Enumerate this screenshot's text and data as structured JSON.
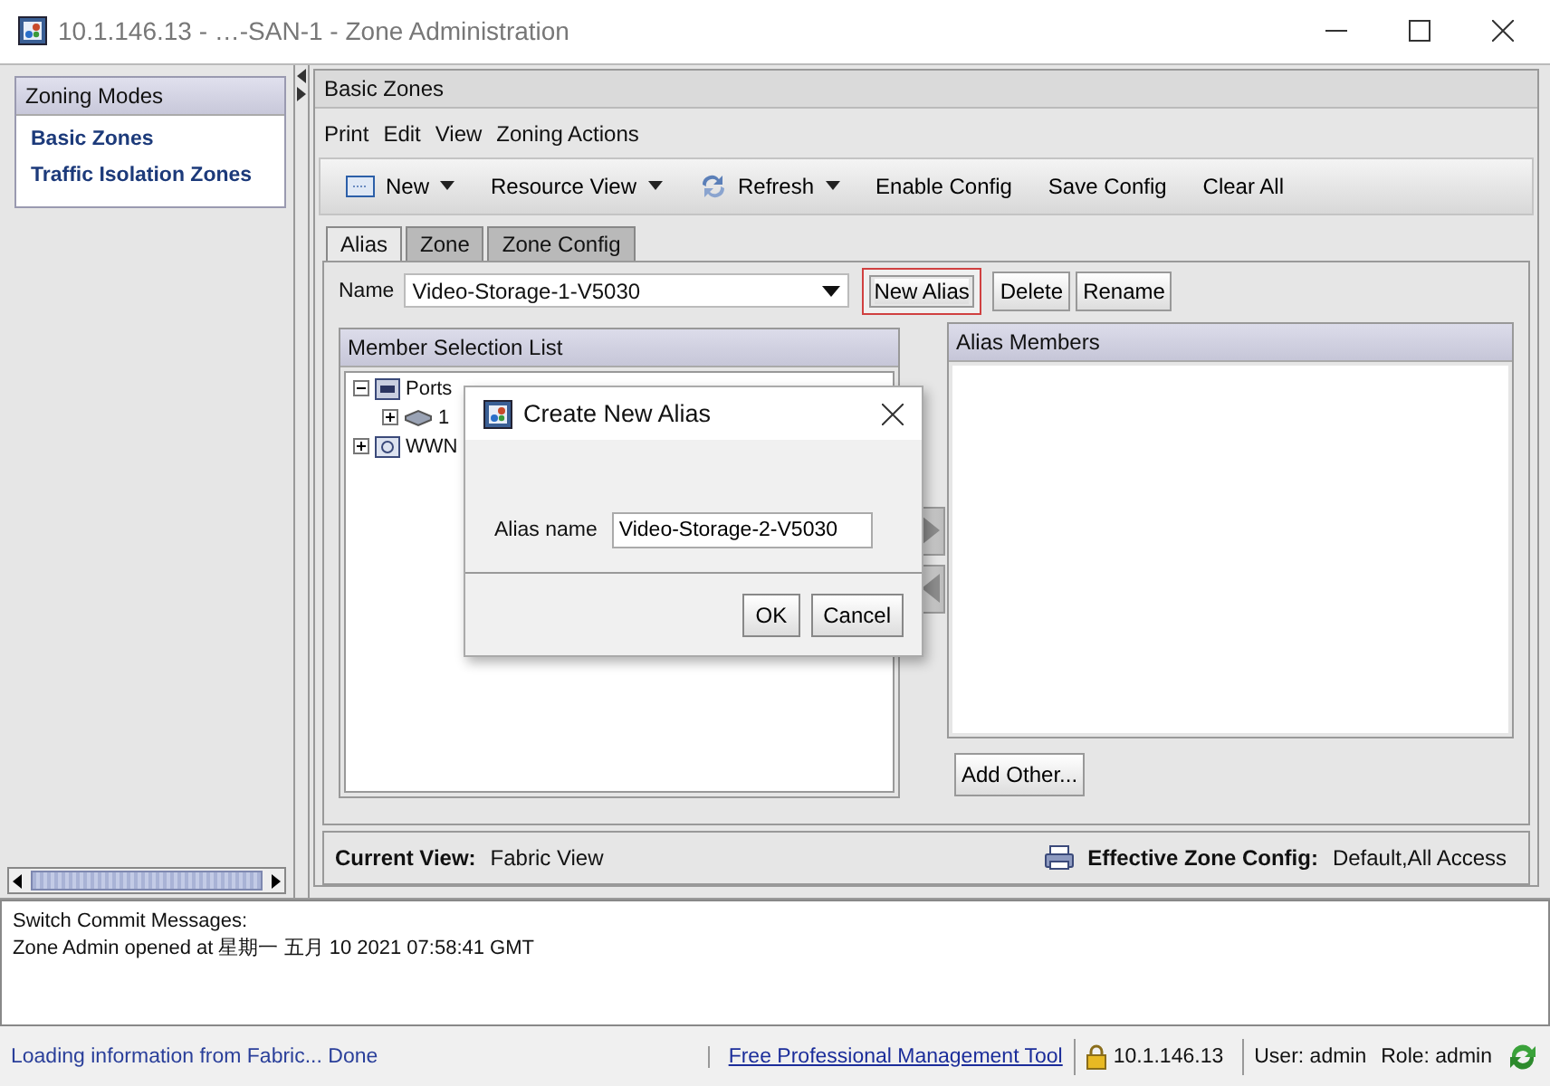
{
  "window": {
    "title": "10.1.146.13 - …-SAN-1 - Zone Administration"
  },
  "sidebar": {
    "title": "Zoning Modes",
    "items": [
      {
        "label": "Basic Zones"
      },
      {
        "label": "Traffic Isolation Zones"
      }
    ]
  },
  "panel": {
    "title": "Basic Zones",
    "menu": [
      "Print",
      "Edit",
      "View",
      "Zoning Actions"
    ],
    "toolbar": [
      {
        "label": "New",
        "kind": "dropdown"
      },
      {
        "label": "Resource View",
        "kind": "dropdown"
      },
      {
        "label": "Refresh",
        "kind": "dropdown"
      },
      {
        "label": "Enable Config",
        "kind": "button"
      },
      {
        "label": "Save Config",
        "kind": "button"
      },
      {
        "label": "Clear All",
        "kind": "button"
      }
    ],
    "tabs": [
      {
        "label": "Alias",
        "selected": true
      },
      {
        "label": "Zone",
        "selected": false
      },
      {
        "label": "Zone Config",
        "selected": false
      }
    ],
    "name_label": "Name",
    "name_value": "Video-Storage-1-V5030",
    "buttons": [
      {
        "label": "New Alias",
        "highlighted": true
      },
      {
        "label": "Delete",
        "highlighted": false
      },
      {
        "label": "Rename",
        "highlighted": false
      }
    ],
    "member_list": {
      "title": "Member Selection List",
      "tree": [
        {
          "label": "Ports",
          "expanded": true,
          "children": [
            {
              "label": "1",
              "expanded": false
            }
          ]
        },
        {
          "label": "WWN",
          "expanded": false
        }
      ]
    },
    "alias_members": {
      "title": "Alias Members"
    },
    "add_button": "Add Other...",
    "footer": {
      "view_label": "Current View:",
      "view_value": "Fabric View",
      "config_label": "Effective Zone Config:",
      "config_value": "Default,All Access"
    }
  },
  "messages": [
    "Switch Commit Messages:",
    "Zone Admin opened at 星期一 五月 10 2021 07:58:41 GMT"
  ],
  "status_bar": {
    "loading": "Loading information from Fabric... Done",
    "link": "Free Professional Management Tool",
    "ip": "10.1.146.13",
    "user": "User: admin",
    "role": "Role: admin"
  },
  "dialog": {
    "title": "Create New Alias",
    "field_label": "Alias name",
    "field_value": "Video-Storage-2-V5030",
    "buttons": [
      "OK",
      "Cancel"
    ]
  }
}
